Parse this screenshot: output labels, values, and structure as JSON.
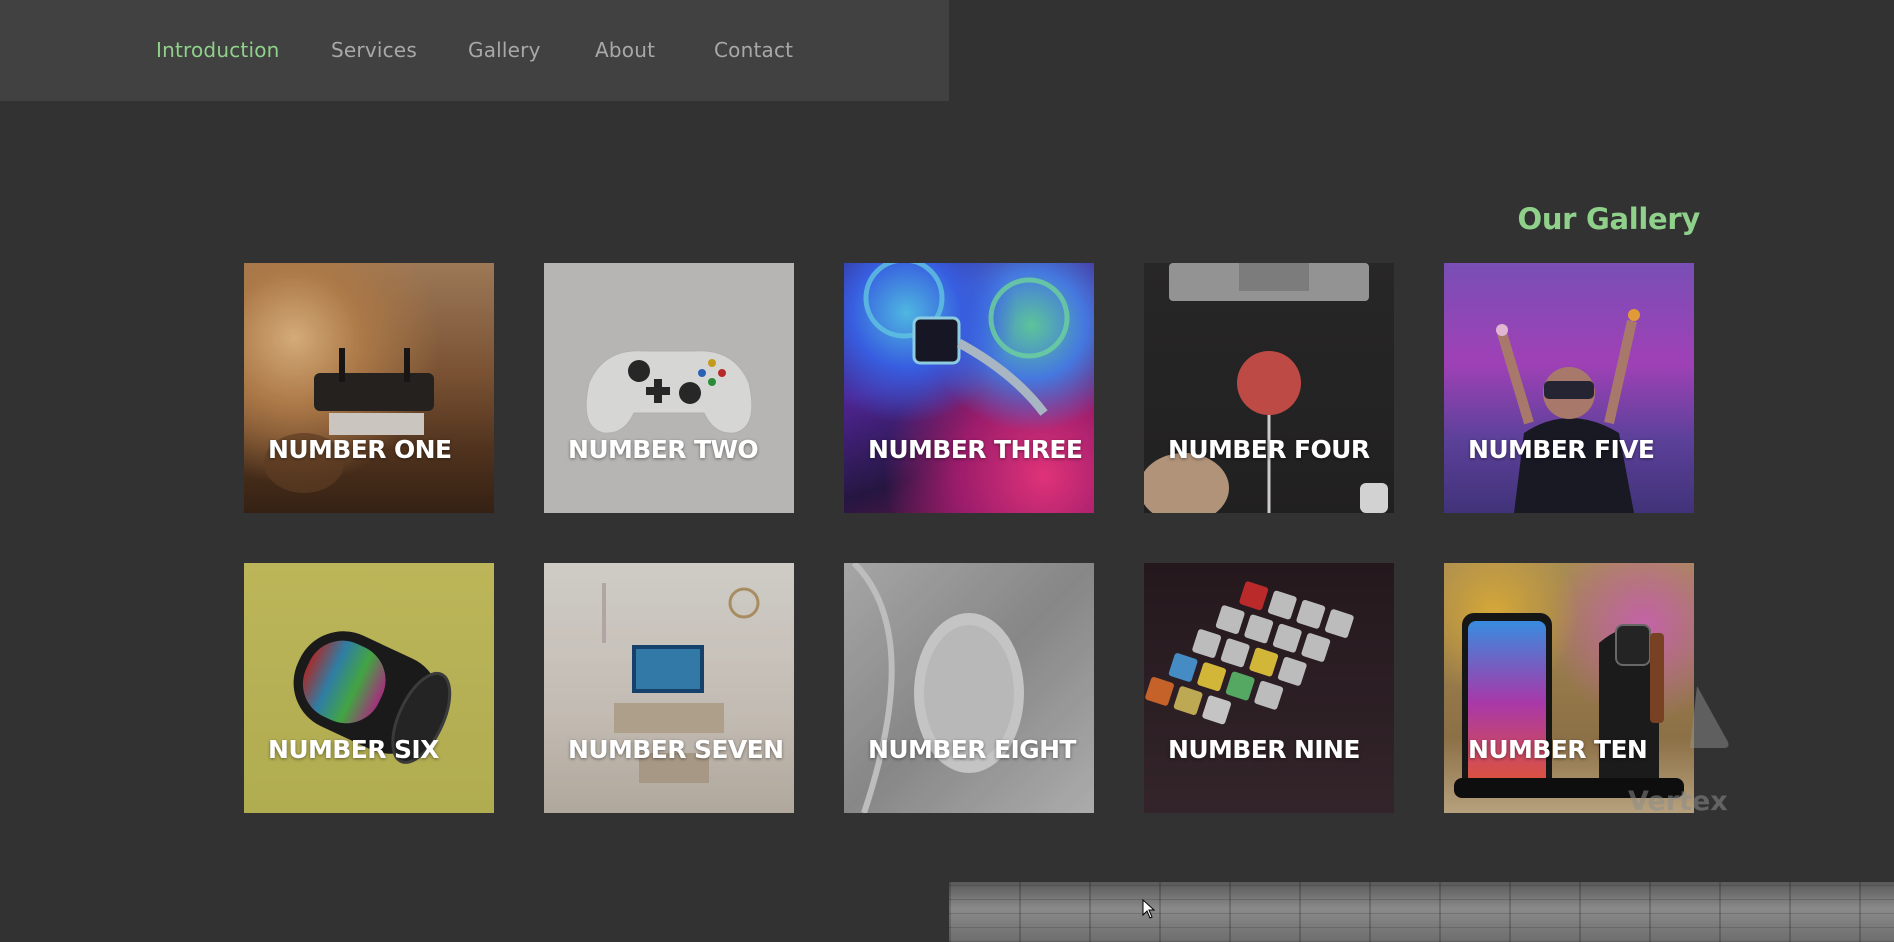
{
  "nav": {
    "items": [
      {
        "label": "Introduction",
        "active": true
      },
      {
        "label": "Services",
        "active": false
      },
      {
        "label": "Gallery",
        "active": false
      },
      {
        "label": "About",
        "active": false
      },
      {
        "label": "Contact",
        "active": false
      }
    ]
  },
  "gallery": {
    "title": "Our Gallery",
    "tiles": [
      {
        "label": "NUMBER ONE"
      },
      {
        "label": "NUMBER TWO"
      },
      {
        "label": "NUMBER THREE"
      },
      {
        "label": "NUMBER FOUR"
      },
      {
        "label": "NUMBER FIVE"
      },
      {
        "label": "NUMBER SIX"
      },
      {
        "label": "NUMBER SEVEN"
      },
      {
        "label": "NUMBER EIGHT"
      },
      {
        "label": "NUMBER NINE"
      },
      {
        "label": "NUMBER TEN"
      }
    ]
  },
  "watermark": {
    "text": "Vertex"
  },
  "colors": {
    "accent": "#8fd18a",
    "background": "#323232",
    "nav_background": "#414141",
    "nav_text": "#a8a8a8"
  }
}
